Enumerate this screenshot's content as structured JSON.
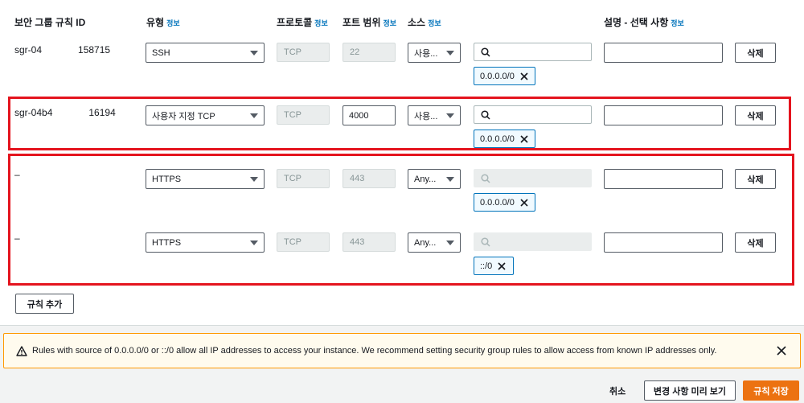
{
  "headers": {
    "rule_id": "보안 그룹 규칙 ID",
    "type": "유형",
    "protocol": "프로토콜",
    "port_range": "포트 범위",
    "source": "소스",
    "description": "설명 - 선택 사항",
    "info": "정보"
  },
  "rows": [
    {
      "id": "sgr-04",
      "id_tail": "158715",
      "type": "SSH",
      "protocol": "TCP",
      "port": "22",
      "source": "사용...",
      "cidr": "0.0.0.0/0"
    },
    {
      "id": "sgr-04b4",
      "id_tail": "16194",
      "type": "사용자 지정 TCP",
      "protocol": "TCP",
      "port": "4000",
      "source": "사용...",
      "cidr": "0.0.0.0/0"
    },
    {
      "id": "–",
      "type": "HTTPS",
      "protocol": "TCP",
      "port": "443",
      "source": "Any...",
      "cidr": "0.0.0.0/0"
    },
    {
      "id": "–",
      "type": "HTTPS",
      "protocol": "TCP",
      "port": "443",
      "source": "Any...",
      "cidr": "::/0"
    }
  ],
  "delete_label": "삭제",
  "add_rule_label": "규칙 추가",
  "warning": {
    "text": "Rules with source of 0.0.0.0/0 or ::/0 allow all IP addresses to access your instance. We recommend setting security group rules to allow access from known IP addresses only."
  },
  "footer": {
    "cancel": "취소",
    "preview": "변경 사항 미리 보기",
    "save": "규칙 저장"
  },
  "colors": {
    "highlight": "#e4141e",
    "primary": "#ec7211",
    "link": "#0073bb",
    "warning": "#ff9900"
  }
}
